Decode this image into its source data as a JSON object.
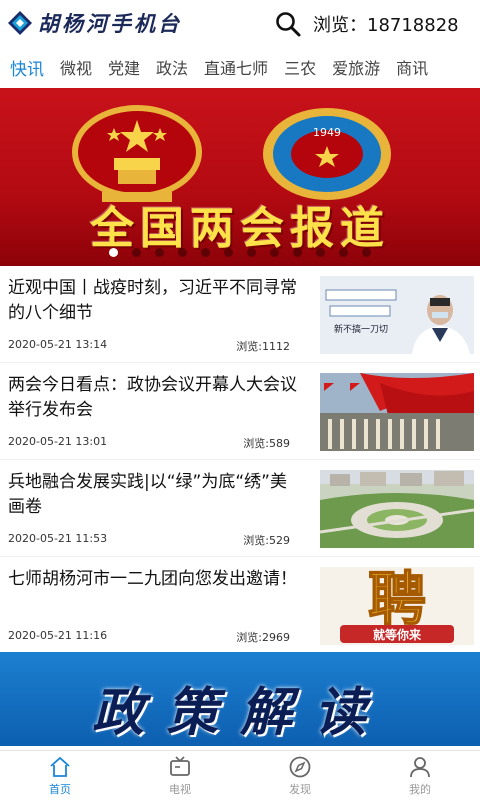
{
  "header": {
    "logo_text": "胡杨河手机台",
    "views_text": "浏览：18718828"
  },
  "tabs": [
    {
      "label": "快讯",
      "active": true
    },
    {
      "label": "微视"
    },
    {
      "label": "党建"
    },
    {
      "label": "政法"
    },
    {
      "label": "直通七师"
    },
    {
      "label": "三农"
    },
    {
      "label": "爱旅游"
    },
    {
      "label": "商讯"
    }
  ],
  "banner": {
    "title": "全国两会报道",
    "emblem_year": "1949",
    "dot_count": 12,
    "active_dot": 0
  },
  "news": [
    {
      "title": "近观中国丨战疫时刻，习近平不同寻常的八个细节",
      "date": "2020-05-21 13:14",
      "views": "浏览:1112"
    },
    {
      "title": "两会今日看点：政协会议开幕人大会议举行发布会",
      "date": "2020-05-21 13:01",
      "views": "浏览:589"
    },
    {
      "title": "兵地融合发展实践|以“绿”为底“绣”美画卷",
      "date": "2020-05-21 11:53",
      "views": "浏览:529"
    },
    {
      "title": "七师胡杨河市一二九团向您发出邀请！",
      "date": "2020-05-21 11:16",
      "views": "浏览:2969"
    }
  ],
  "thumb_texts": {
    "t1_caption": "新不搞一刀切",
    "t4_big": "聘",
    "t4_small": "就等你来"
  },
  "policy_banner": {
    "title": "政策解读"
  },
  "bottom_nav": [
    {
      "label": "首页",
      "icon": "home-icon",
      "active": true
    },
    {
      "label": "电视",
      "icon": "tv-icon"
    },
    {
      "label": "发现",
      "icon": "compass-icon"
    },
    {
      "label": "我的",
      "icon": "user-icon"
    }
  ],
  "colors": {
    "accent": "#1a86d8",
    "banner_red": "#c8121a",
    "banner_text": "#ffe24a",
    "policy_blue": "#1d7fd0"
  }
}
